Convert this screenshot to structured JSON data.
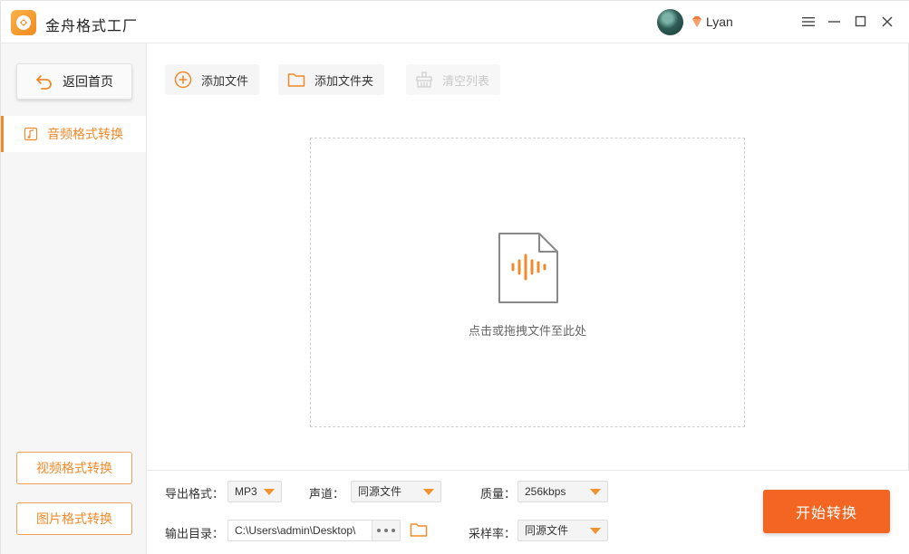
{
  "app": {
    "title": "金舟格式工厂",
    "accent_color": "#f08a2a",
    "start_color": "#f26522"
  },
  "user": {
    "name": "Lyan",
    "avatar_icon": "avatar-photo",
    "vip_icon": "diamond-icon"
  },
  "window_controls": [
    "menu-icon",
    "minimize-icon",
    "maximize-icon",
    "close-icon"
  ],
  "sidebar": {
    "home_label": "返回首页",
    "active_item": "音频格式转换",
    "video_label": "视频格式转换",
    "image_label": "图片格式转换"
  },
  "toolbar": {
    "add_file": "添加文件",
    "add_folder": "添加文件夹",
    "clear_list": "清空列表"
  },
  "dropzone": {
    "hint": "点击或拖拽文件至此处",
    "icon": "audio-file-icon"
  },
  "settings": {
    "format_label": "导出格式：",
    "format_value": "MP3",
    "channel_label": "声道：",
    "channel_value": "同源文件",
    "quality_label": "质量：",
    "quality_value": "256kbps",
    "output_label": "输出目录：",
    "output_value": "C:\\Users\\admin\\Desktop\\",
    "samplerate_label": "采样率：",
    "samplerate_value": "同源文件"
  },
  "start_button": "开始转换"
}
